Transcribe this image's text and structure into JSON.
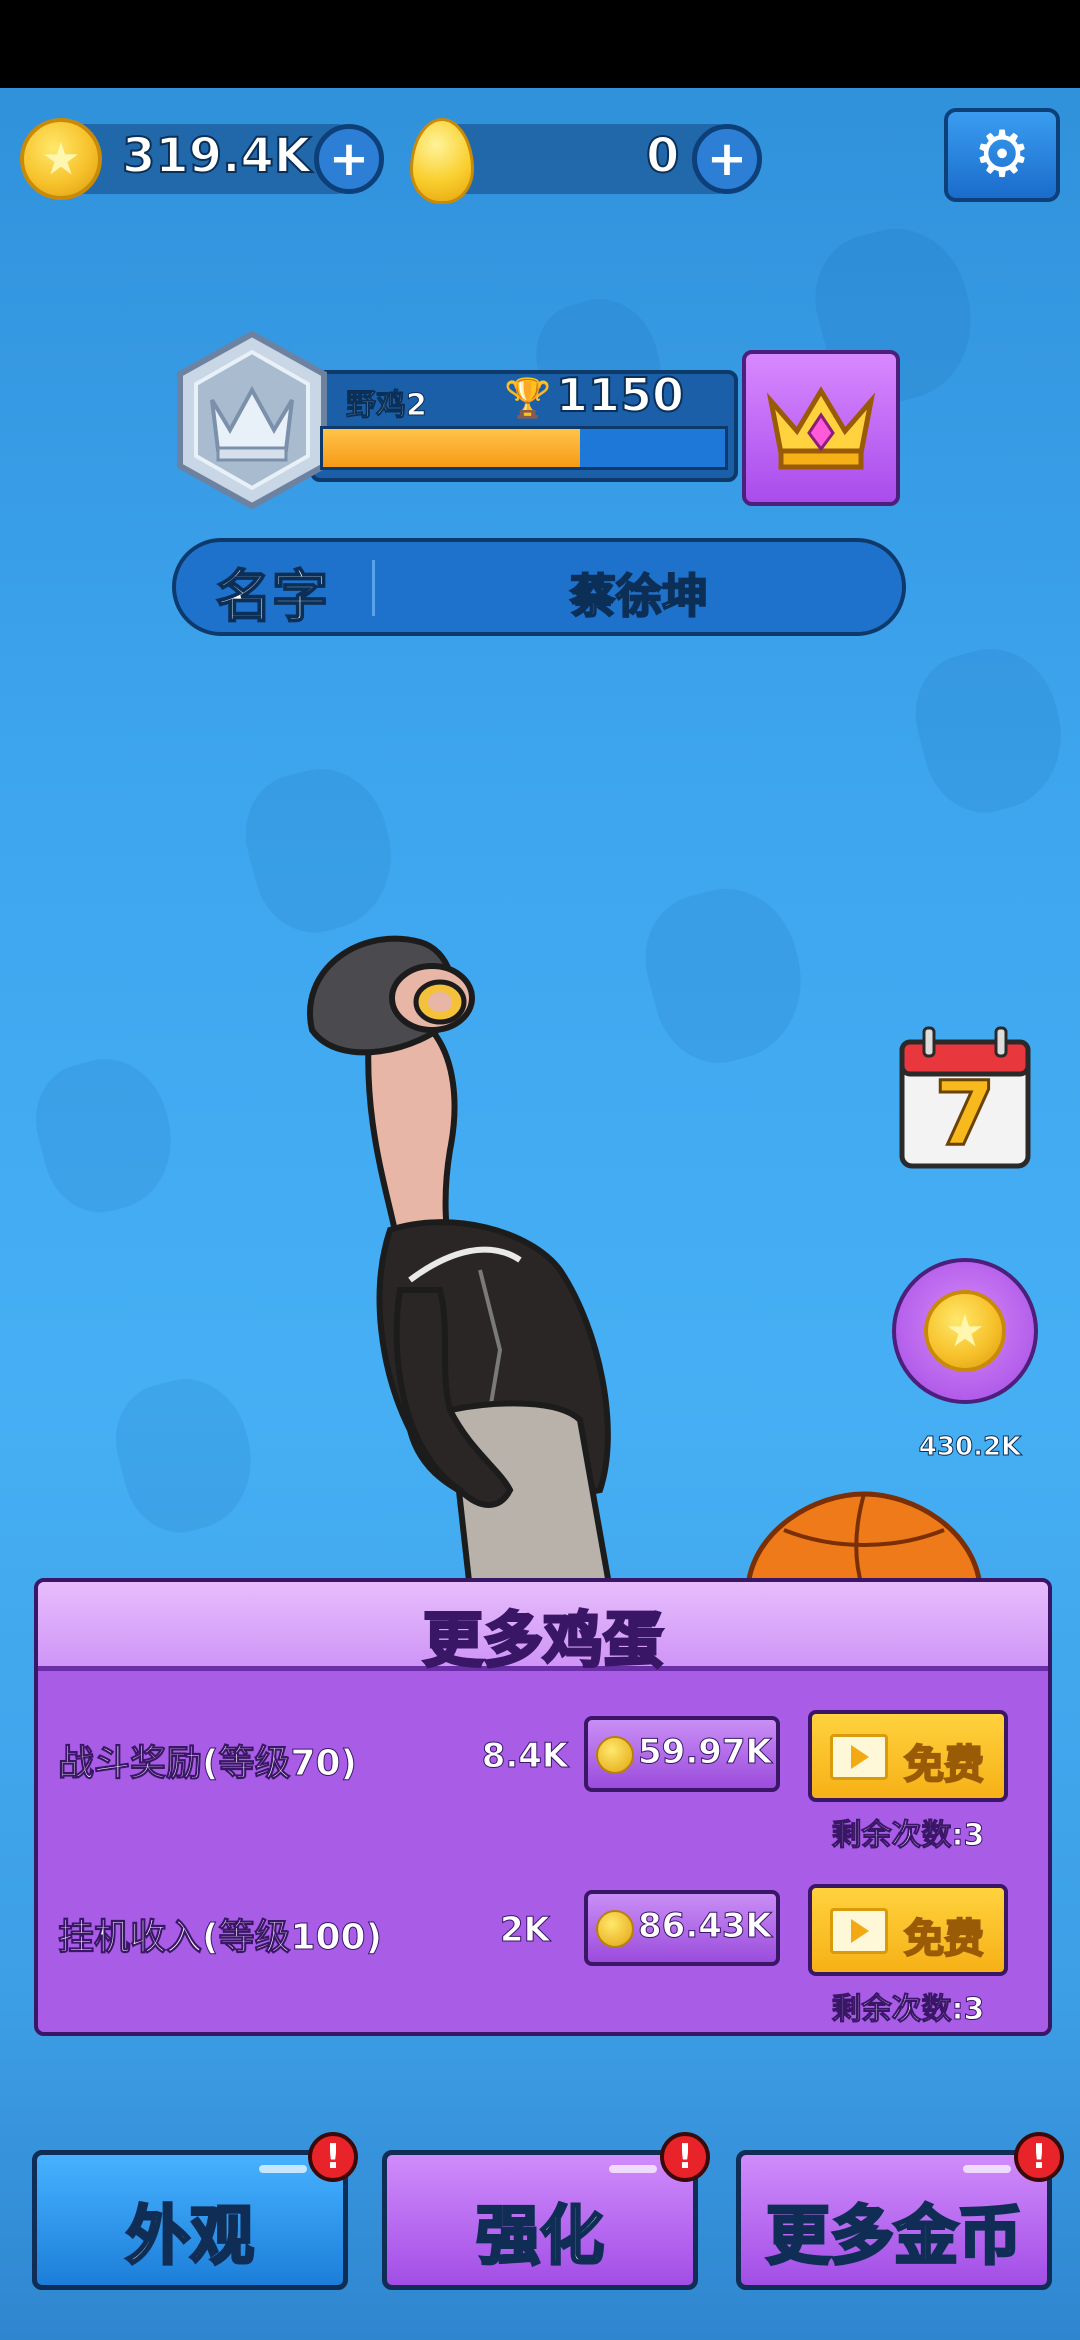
{
  "currency": {
    "coins": "319.4K",
    "eggs": "0"
  },
  "rank": {
    "name": "野鸡2",
    "trophies": "1150",
    "progress": 0.64
  },
  "profile": {
    "name_label": "名字",
    "name_value": "蔡徐坤"
  },
  "side": {
    "calendar_day": "7",
    "coin_reward": "430.2K"
  },
  "panel": {
    "title": "更多鸡蛋",
    "rows": [
      {
        "label": "战斗奖励(等级70)",
        "value": "8.4K",
        "price": "59.97K",
        "free": "免费",
        "remaining": "剩余次数:3"
      },
      {
        "label": "挂机收入(等级100)",
        "value": "2K",
        "price": "86.43K",
        "free": "免费",
        "remaining": "剩余次数:3"
      }
    ]
  },
  "bottom_nav": {
    "appearance": "外观",
    "upgrade": "强化",
    "more_coins": "更多金币",
    "alert": "!"
  },
  "colors": {
    "background": "#3ea6ef",
    "panel": "#a95ce6",
    "accent_yellow": "#f7c22c"
  }
}
